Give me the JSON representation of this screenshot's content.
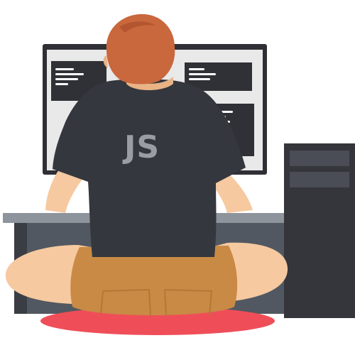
{
  "shirt": {
    "text": "JS"
  },
  "colors": {
    "background": "#ffffff",
    "monitor_frame": "#2f2f35",
    "monitor_screen": "#e9e9e9",
    "code_panel": "#2f3136",
    "code_line": "#ffffff",
    "desk_top": "#8e949c",
    "desk_body": "#525861",
    "desk_leg": "#3a3e44",
    "tower": "#34363c",
    "tower_slot": "#4a4d55",
    "skin": "#f6c9a0",
    "skin_shadow": "#e9b386",
    "hair": "#c9673d",
    "hair_shadow": "#b3552e",
    "shirt": "#34373d",
    "shirt_text": "#9a9da2",
    "shorts": "#c98a45",
    "shorts_shadow": "#b47737",
    "cushion": "#ef4e58"
  },
  "icons": {
    "person": "person-back-view-icon",
    "monitor": "monitor-icon",
    "tower": "computer-tower-icon"
  }
}
